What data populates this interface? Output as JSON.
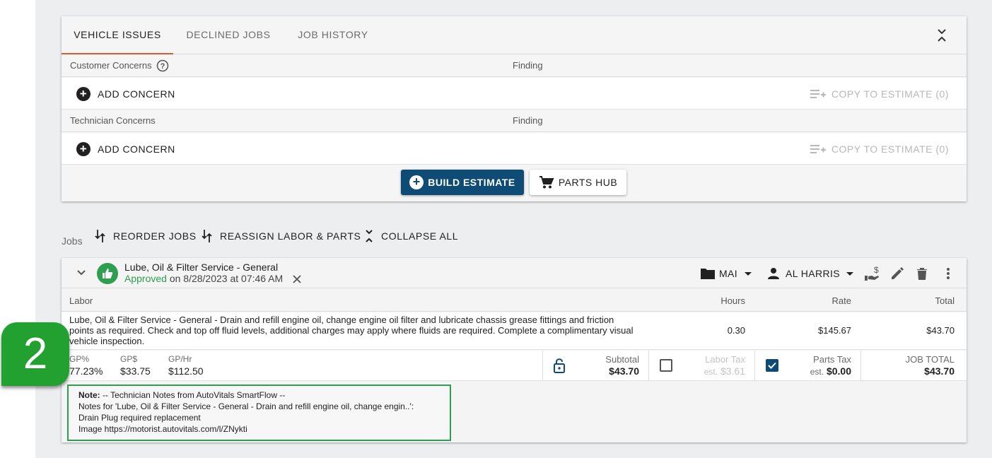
{
  "issues_tabs": [
    {
      "label": "VEHICLE ISSUES",
      "active": true
    },
    {
      "label": "DECLINED JOBS",
      "active": false
    },
    {
      "label": "JOB HISTORY",
      "active": false
    }
  ],
  "customer_section": {
    "header": "Customer Concerns",
    "finding": "Finding",
    "add_label": "ADD CONCERN",
    "copy_label": "COPY TO ESTIMATE (0)"
  },
  "technician_section": {
    "header": "Technician Concerns",
    "finding": "Finding",
    "add_label": "ADD CONCERN",
    "copy_label": "COPY TO ESTIMATE (0)"
  },
  "actions": {
    "build_estimate": "BUILD ESTIMATE",
    "parts_hub": "PARTS HUB"
  },
  "jobs_toolbar": {
    "label": "Jobs",
    "reorder": "REORDER JOBS",
    "reassign": "REASSIGN LABOR & PARTS",
    "collapse": "COLLAPSE ALL"
  },
  "job": {
    "title": "Lube, Oil & Filter Service - General",
    "status": "Approved",
    "status_detail": " on 8/28/2023 at 07:46 AM",
    "folder": "MAI",
    "technician": "AL HARRIS",
    "labor_headers": {
      "labor": "Labor",
      "hours": "Hours",
      "rate": "Rate",
      "total": "Total"
    },
    "labor_line": {
      "description": "Lube, Oil & Filter Service - General -  Drain and refill engine oil, change engine oil filter and lubricate chassis grease fittings and friction points as required.  Check and top off fluid levels, additional charges may apply where fluids are required.  Complete a complimentary visual vehicle inspection.",
      "hours": "0.30",
      "rate": "$145.67",
      "total": "$43.70"
    },
    "gp": [
      {
        "label": "GP%",
        "value": "77.23%"
      },
      {
        "label": "GP$",
        "value": "$33.75"
      },
      {
        "label": "GP/Hr",
        "value": "$112.50"
      }
    ],
    "subtotal": {
      "label": "Subtotal",
      "value": "$43.70"
    },
    "labor_tax": {
      "label": "Labor Tax",
      "est": "est.",
      "value": "$3.61",
      "checked": false
    },
    "parts_tax": {
      "label": "Parts Tax",
      "est": "est.",
      "value": "$0.00",
      "checked": true
    },
    "job_total": {
      "label": "JOB TOTAL",
      "value": "$43.70"
    },
    "note": {
      "label": "Note:",
      "line1": " -- Technician Notes from AutoVitals SmartFlow --",
      "line2": "Notes for 'Lube, Oil & Filter Service - General - Drain and refill engine oil, change engin..':",
      "line3": "Drain Plug required replacement",
      "line4": "Image https://motorist.autovitals.com/l/ZNykti"
    }
  },
  "callout_badge": "2",
  "colors": {
    "accent_orange": "#e4572e",
    "primary_blue": "#0f4c75",
    "approved_green": "#2e9e4f",
    "callout_green": "#22a030"
  }
}
